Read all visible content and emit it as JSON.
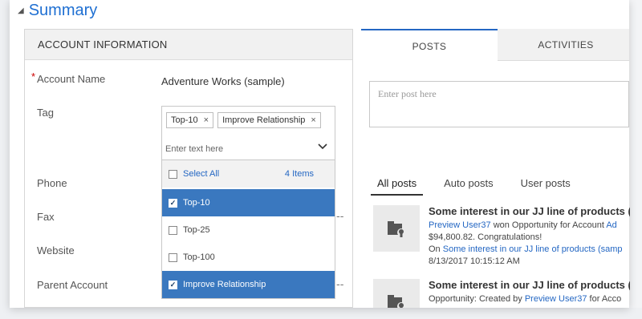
{
  "summary": {
    "title": "Summary"
  },
  "account": {
    "header": "ACCOUNT INFORMATION",
    "fields": {
      "name": {
        "label": "Account Name",
        "value": "Adventure Works (sample)"
      },
      "tag": {
        "label": "Tag"
      },
      "phone": {
        "label": "Phone"
      },
      "fax": {
        "label": "Fax",
        "value": "--"
      },
      "website": {
        "label": "Website"
      },
      "parent": {
        "label": "Parent Account",
        "value": "--"
      }
    }
  },
  "tag_control": {
    "chips": [
      "Top-10",
      "Improve Relationship"
    ],
    "input_placeholder": "Enter text here",
    "select_all": "Select All",
    "count": "4 Items",
    "options": [
      {
        "label": "Top-10",
        "checked": true
      },
      {
        "label": "Top-25",
        "checked": false
      },
      {
        "label": "Top-100",
        "checked": false
      },
      {
        "label": "Improve Relationship",
        "checked": true
      }
    ]
  },
  "tabs": {
    "posts": "POSTS",
    "activities": "ACTIVITIES"
  },
  "post_box": {
    "placeholder": "Enter post here"
  },
  "feed_tabs": {
    "all": "All posts",
    "auto": "Auto posts",
    "user": "User posts"
  },
  "posts": [
    {
      "title": "Some interest in our JJ line of products (",
      "user": "Preview User37",
      "line1_rest": " won Opportunity for Account ",
      "line1_link2": "Ad",
      "line2": "$94,800.82. Congratulations!",
      "line3_prefix": "On ",
      "line3_link": "Some interest in our JJ line of products (samp",
      "time": "8/13/2017 10:15:12 AM"
    },
    {
      "title": "Some interest in our JJ line of products (",
      "line1_prefix": "Opportunity: Created by ",
      "user": "Preview User37",
      "line1_rest": " for Acco"
    }
  ],
  "colors": {
    "accent": "#2467c3",
    "selected": "#3a78bf",
    "required": "#cc0000"
  },
  "icons": [
    "collapse-triangle-icon",
    "remove-chip-icon",
    "chevron-down-icon",
    "checkbox-icon",
    "record-post-icon"
  ]
}
